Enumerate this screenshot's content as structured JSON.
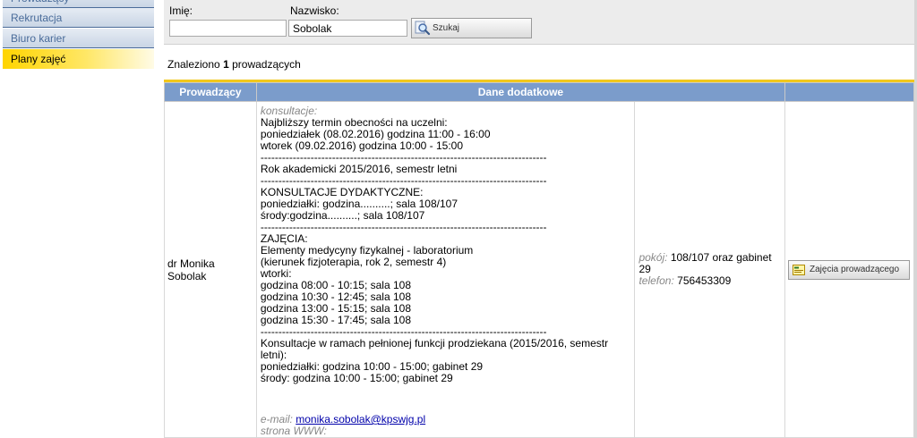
{
  "sidebar": {
    "items": [
      {
        "label": "Prowadzący"
      },
      {
        "label": "Rekrutacja"
      },
      {
        "label": "Biuro karier"
      },
      {
        "label": "Plany zajęć"
      }
    ]
  },
  "search": {
    "imie_label": "Imię:",
    "imie_value": "",
    "nazwisko_label": "Nazwisko:",
    "nazwisko_value": "Sobolak",
    "button_label": "Szukaj"
  },
  "results": {
    "found_prefix": "Znaleziono",
    "found_count": "1",
    "found_suffix": "prowadzących",
    "headers": [
      "Prowadzący",
      "Dane dodatkowe",
      ""
    ],
    "row": {
      "name": "dr Monika Sobolak",
      "konsultacje_label": "konsultacje:",
      "block1": [
        "Najbliższy termin obecności na uczelni:",
        "poniedziałek (08.02.2016) godzina 11:00 - 16:00",
        "wtorek (09.02.2016) godzina 10:00 - 15:00"
      ],
      "separator": "--------------------------------------------------------------------------------",
      "block2": [
        "Rok akademicki 2015/2016, semestr letni"
      ],
      "block3": [
        "KONSULTACJE DYDAKTYCZNE:",
        "poniedziałki: godzina..........; sala 108/107",
        "środy:godzina..........; sala 108/107"
      ],
      "block4": [
        "ZAJĘCIA:",
        "Elementy medycyny fizykalnej - laboratorium",
        "(kierunek fizjoterapia, rok 2, semestr 4)",
        "wtorki:",
        "godzina 08:00 - 10:15; sala 108",
        "godzina 10:30 - 12:45; sala 108",
        "godzina 13:00 - 15:15; sala 108",
        "godzina 15:30 - 17:45; sala 108"
      ],
      "block5": [
        "Konsultacje w ramach pełnionej funkcji prodziekana (2015/2016, semestr letni):",
        "poniedziałki: godzina 10:00 - 15:00; gabinet 29",
        "środy: godzina 10:00 - 15:00; gabinet 29"
      ],
      "email_label": "e-mail:",
      "email_value": "monika.sobolak@kpswjg.pl",
      "www_label": "strona WWW:",
      "pokoj_label": "pokój:",
      "pokoj_value": "108/107 oraz gabinet 29",
      "telefon_label": "telefon:",
      "telefon_value": "756453309",
      "button_label": "Zajęcia prowadzącego"
    }
  },
  "colors": {
    "header_blue": "#7b9ccb",
    "active_yellow": "#ffd400",
    "gold_line": "#f2c81b",
    "sidebar_text": "#4a6c9a"
  },
  "icons": {
    "search_button": "search-magnifier-icon",
    "schedule_button": "schedule-card-icon"
  }
}
